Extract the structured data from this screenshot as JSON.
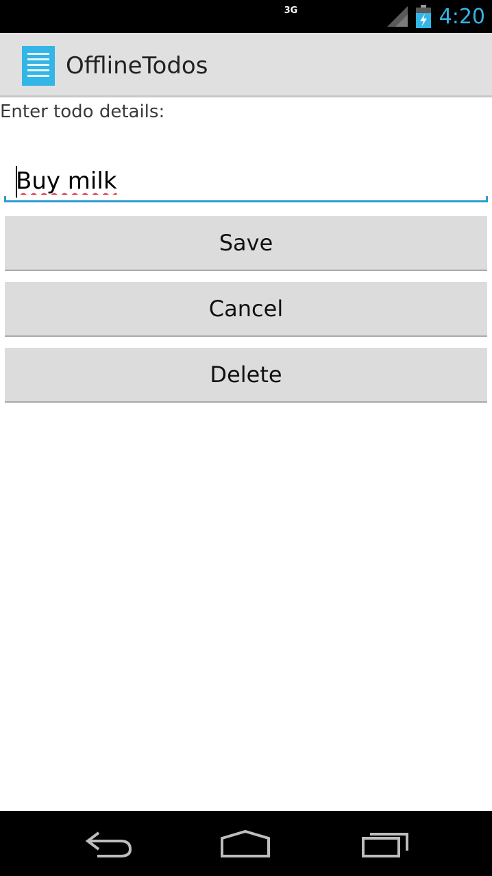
{
  "status_bar": {
    "network_type": "3G",
    "time": "4:20",
    "signal_icon": "signal-icon",
    "battery_icon": "battery-charging-icon"
  },
  "action_bar": {
    "app_icon": "list-document-icon",
    "title": "OfflineTodos"
  },
  "form": {
    "prompt": "Enter todo details:",
    "todo_input_value": "Buy milk"
  },
  "buttons": {
    "save": "Save",
    "cancel": "Cancel",
    "delete": "Delete"
  },
  "nav_bar": {
    "back_icon": "back-icon",
    "home_icon": "home-icon",
    "recents_icon": "recents-icon"
  },
  "colors": {
    "accent": "#33b5e5",
    "input_underline": "#2a9ccd",
    "spellcheck": "#e8505b",
    "action_bar_bg": "#e0e0e0",
    "button_bg": "#dddcdd"
  }
}
